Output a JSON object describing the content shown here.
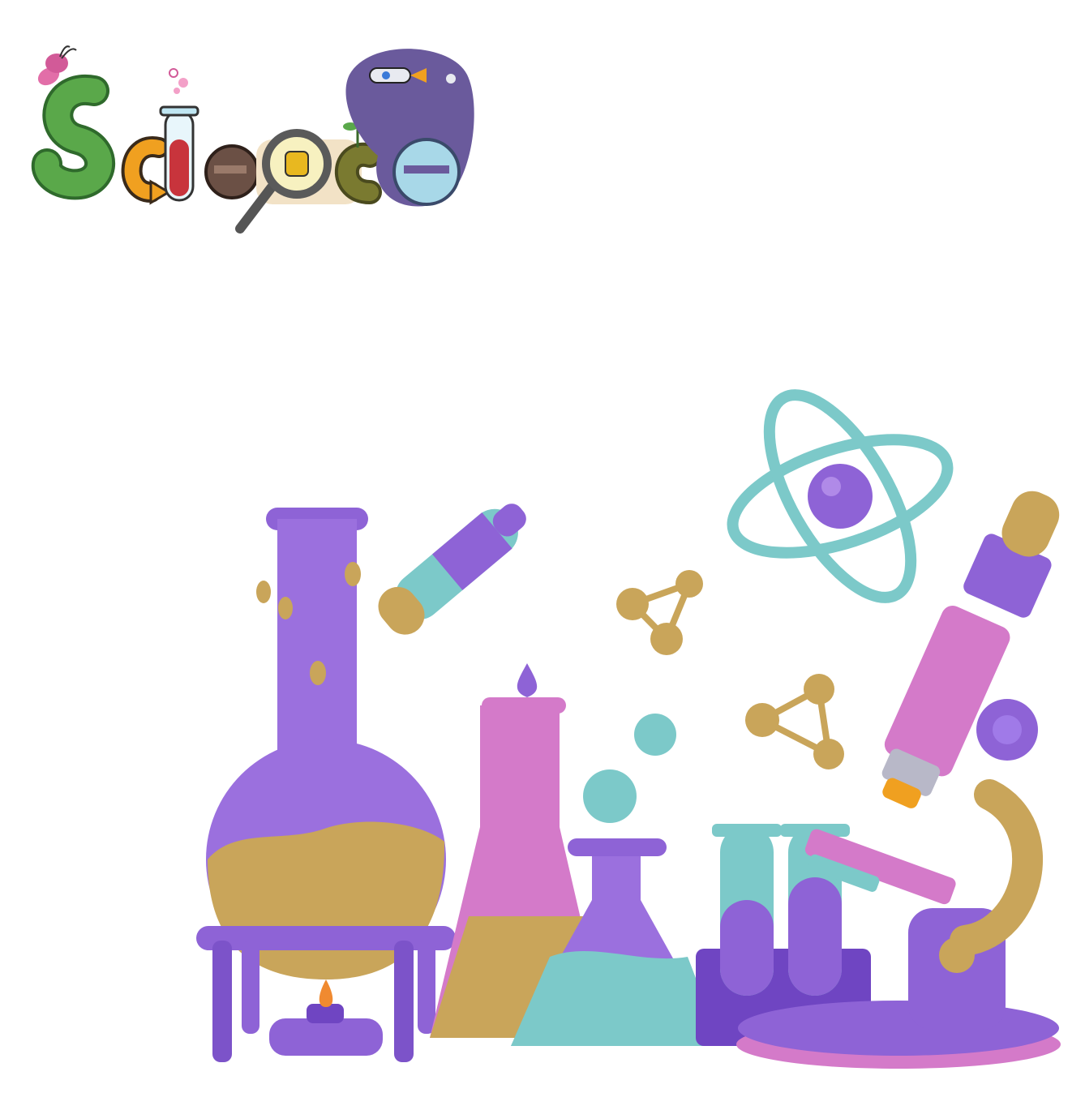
{
  "logo": {
    "word": "Science",
    "letters": [
      "S",
      "c",
      "i",
      "e",
      "n",
      "c",
      "e"
    ],
    "icon": "science-wordmark"
  },
  "illustration": {
    "icon": "laboratory-equipment-3d",
    "items": [
      "round-bottom-flask-icon",
      "dropper-icon",
      "erlenmeyer-flask-tall-icon",
      "erlenmeyer-flask-short-icon",
      "test-tube-rack-icon",
      "microscope-icon",
      "atom-icon",
      "molecule-icon",
      "bunsen-burner-icon"
    ]
  },
  "colors": {
    "purple": "#8e63d6",
    "purple_dark": "#6f45c2",
    "pink": "#d47ac9",
    "mustard": "#c9a55a",
    "teal": "#7cc9c9",
    "green": "#5aa84a",
    "orange": "#f0a020",
    "red": "#c8343c",
    "brown": "#6b5045",
    "space": "#6a5a9c"
  }
}
